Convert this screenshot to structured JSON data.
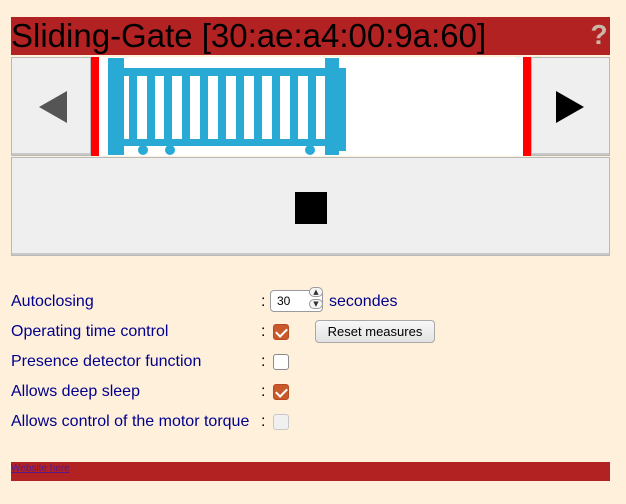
{
  "header": {
    "title": "Sliding-Gate [30:ae:a4:00:9a:60]",
    "help_label": "?"
  },
  "controls": {
    "open_left_icon": "triangle-left-icon",
    "open_right_icon": "triangle-right-icon",
    "stop_icon": "stop-square-icon"
  },
  "colors": {
    "title_bar": "#b22222",
    "background": "#fff0dc",
    "gate": "#29aad4",
    "rail": "#ff0000",
    "label": "#00008b"
  },
  "settings": {
    "autoclosing": {
      "label": "Autoclosing",
      "colon": ":",
      "value": "30",
      "unit": "secondes"
    },
    "operating_time": {
      "label": "Operating time control",
      "colon": ":",
      "checked": true,
      "reset_label": "Reset measures"
    },
    "presence_detector": {
      "label": "Presence detector function",
      "colon": ":",
      "checked": false
    },
    "deep_sleep": {
      "label": "Allows deep sleep",
      "colon": ":",
      "checked": true
    },
    "motor_torque": {
      "label": "Allows control of the motor torque",
      "colon": ":",
      "checked": false,
      "disabled": true
    }
  },
  "footer": {
    "link_label": "Website here"
  }
}
